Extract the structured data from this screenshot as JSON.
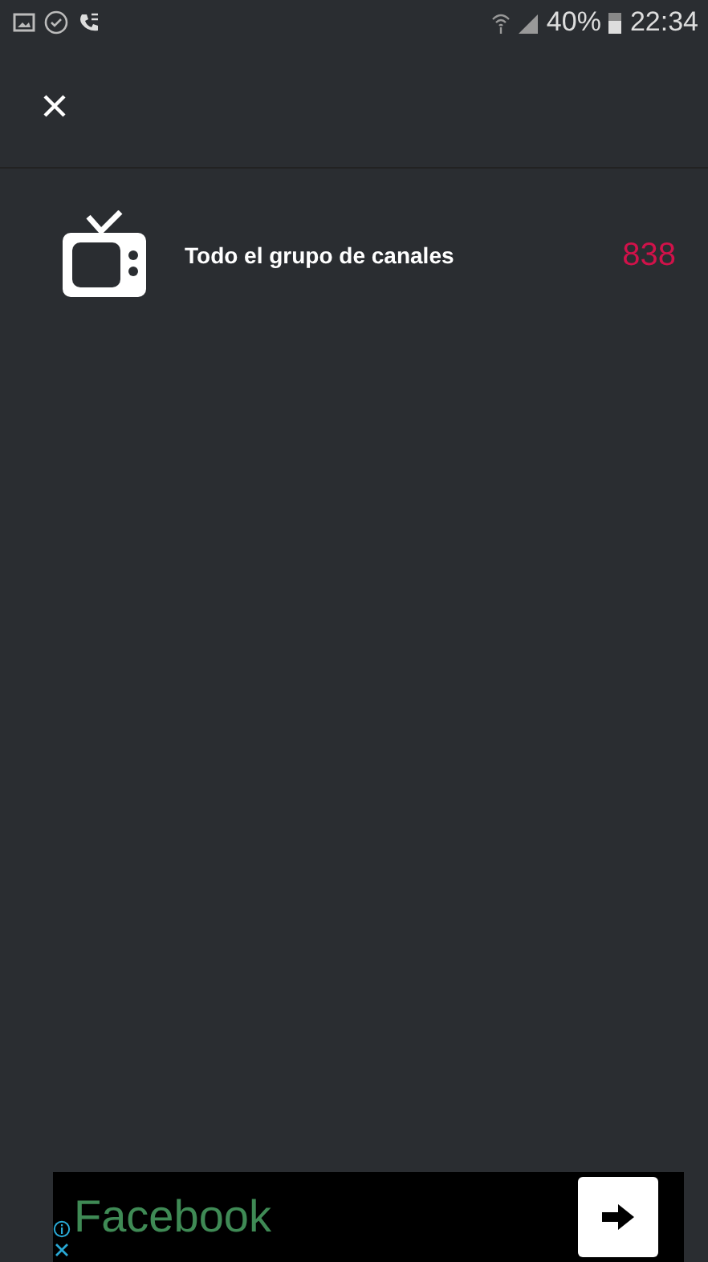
{
  "status_bar": {
    "battery_percent": "40%",
    "time": "22:34"
  },
  "groups": [
    {
      "name": "Todo el grupo de canales",
      "count": "838"
    }
  ],
  "ad": {
    "text": "Facebook"
  }
}
